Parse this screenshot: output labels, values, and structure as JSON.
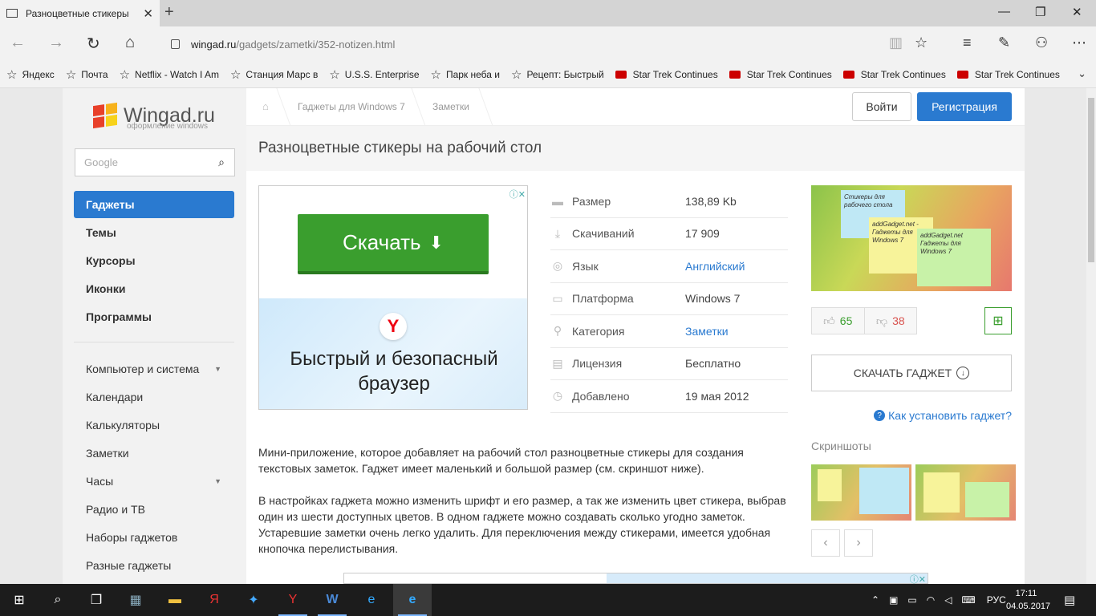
{
  "browser": {
    "tab_title": "Разноцветные стикеры",
    "url_host": "wingad.ru",
    "url_path": "/gadgets/zametki/352-notizen.html"
  },
  "favorites": [
    {
      "label": "Яндекс",
      "icon": "star-icon"
    },
    {
      "label": "Почта",
      "icon": "star-icon"
    },
    {
      "label": "Netflix - Watch I Am",
      "icon": "star-icon"
    },
    {
      "label": "Станция Марс в",
      "icon": "star-icon"
    },
    {
      "label": "U.S.S. Enterprise",
      "icon": "star-icon"
    },
    {
      "label": "Парк неба и",
      "icon": "star-icon"
    },
    {
      "label": "Рецепт: Быстрый",
      "icon": "star-icon"
    },
    {
      "label": "Star Trek Continues",
      "icon": "youtube-icon"
    },
    {
      "label": "Star Trek Continues",
      "icon": "youtube-icon"
    },
    {
      "label": "Star Trek Continues",
      "icon": "youtube-icon"
    },
    {
      "label": "Star Trek Continues",
      "icon": "youtube-icon"
    }
  ],
  "site": {
    "logo_text": "Wingad.ru",
    "logo_sub": "оформление windows",
    "search_placeholder": "Google",
    "menu": [
      "Гаджеты",
      "Темы",
      "Курсоры",
      "Иконки",
      "Программы"
    ],
    "submenu": [
      {
        "label": "Компьютер и система",
        "has_caret": true
      },
      {
        "label": "Календари",
        "has_caret": false
      },
      {
        "label": "Калькуляторы",
        "has_caret": false
      },
      {
        "label": "Заметки",
        "has_caret": false
      },
      {
        "label": "Часы",
        "has_caret": true
      },
      {
        "label": "Радио и ТВ",
        "has_caret": false
      },
      {
        "label": "Наборы гаджетов",
        "has_caret": false
      },
      {
        "label": "Разные гаджеты",
        "has_caret": false
      }
    ],
    "breadcrumbs": [
      "Гаджеты для Windows 7",
      "Заметки"
    ],
    "login_label": "Войти",
    "register_label": "Регистрация"
  },
  "gadget": {
    "title": "Разноцветные стикеры на рабочий стол",
    "info": [
      {
        "label": "Размер",
        "value": "138,89 Kb",
        "link": false,
        "icon": "drive-icon"
      },
      {
        "label": "Скачиваний",
        "value": "17 909",
        "link": false,
        "icon": "download-icon"
      },
      {
        "label": "Язык",
        "value": "Английский",
        "link": true,
        "icon": "globe-icon"
      },
      {
        "label": "Платформа",
        "value": "Windows 7",
        "link": false,
        "icon": "window-icon"
      },
      {
        "label": "Категория",
        "value": "Заметки",
        "link": true,
        "icon": "tree-icon"
      },
      {
        "label": "Лицензия",
        "value": "Бесплатно",
        "link": false,
        "icon": "document-icon"
      },
      {
        "label": "Добавлено",
        "value": "19 мая 2012",
        "link": false,
        "icon": "clock-icon"
      }
    ],
    "likes": "65",
    "dislikes": "38",
    "download_label": "СКАЧАТЬ ГАДЖЕТ",
    "howto_label": "Как установить гаджет?",
    "screenshots_title": "Скриншоты",
    "preview_notes": [
      "Стикеры для рабочего стола",
      "addGadget.net - Гаджеты для Windows 7",
      "addGadget.net Гаджеты для Windows 7"
    ],
    "description": [
      "Мини-приложение, которое добавляет на рабочий стол разноцветные стикеры для создания текстовых заметок. Гаджет имеет маленький и большой размер (см. скриншот ниже).",
      "В настройках гаджета можно изменить шрифт и его размер, а так же изменить цвет стикера, выбрав один из шести доступных цветов. В одном гаджете можно создавать сколько угодно заметок. Устаревшие заметки очень легко удалить. Для переключения между стикерами, имеется удобная кнопочка перелистывания."
    ]
  },
  "ad": {
    "button_label": "Скачать",
    "text": "Быстрый и безопасный браузер",
    "logo_letter": "Y"
  },
  "taskbar": {
    "lang": "РУС",
    "time": "17:11",
    "date": "04.05.2017"
  },
  "colors": {
    "accent": "#2a7ad0",
    "green": "#3a9e2e",
    "dislike": "#d9534f"
  }
}
